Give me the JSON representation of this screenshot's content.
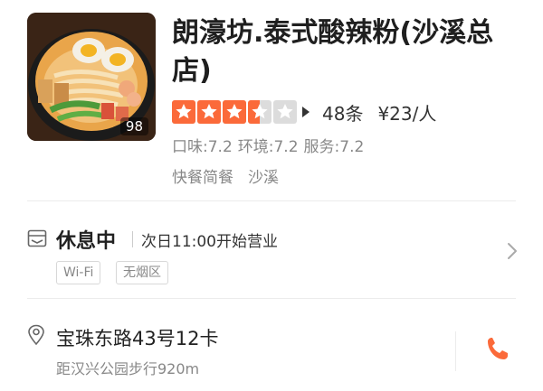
{
  "restaurant": {
    "name": "朗濠坊.泰式酸辣粉(沙溪总店)",
    "photo_count": "98",
    "rating_stars": 3.5,
    "reviews": "48条",
    "price": "¥23/人",
    "scores": {
      "taste": "口味:7.2",
      "environment": "环境:7.2",
      "service": "服务:7.2"
    },
    "category": "快餐简餐",
    "area": "沙溪"
  },
  "status": {
    "state": "休息中",
    "next_open": "次日11:00开始营业",
    "amenities": [
      "Wi-Fi",
      "无烟区"
    ]
  },
  "location": {
    "address": "宝珠东路43号12卡",
    "distance": "距汉兴公园步行920m"
  },
  "colors": {
    "accent": "#fb6a3a",
    "star_empty": "#dcdcdc",
    "muted_text": "#888888"
  },
  "icons": {
    "status": "store-icon",
    "location": "map-pin-icon",
    "phone": "phone-icon",
    "chevron": "chevron-right-icon"
  }
}
